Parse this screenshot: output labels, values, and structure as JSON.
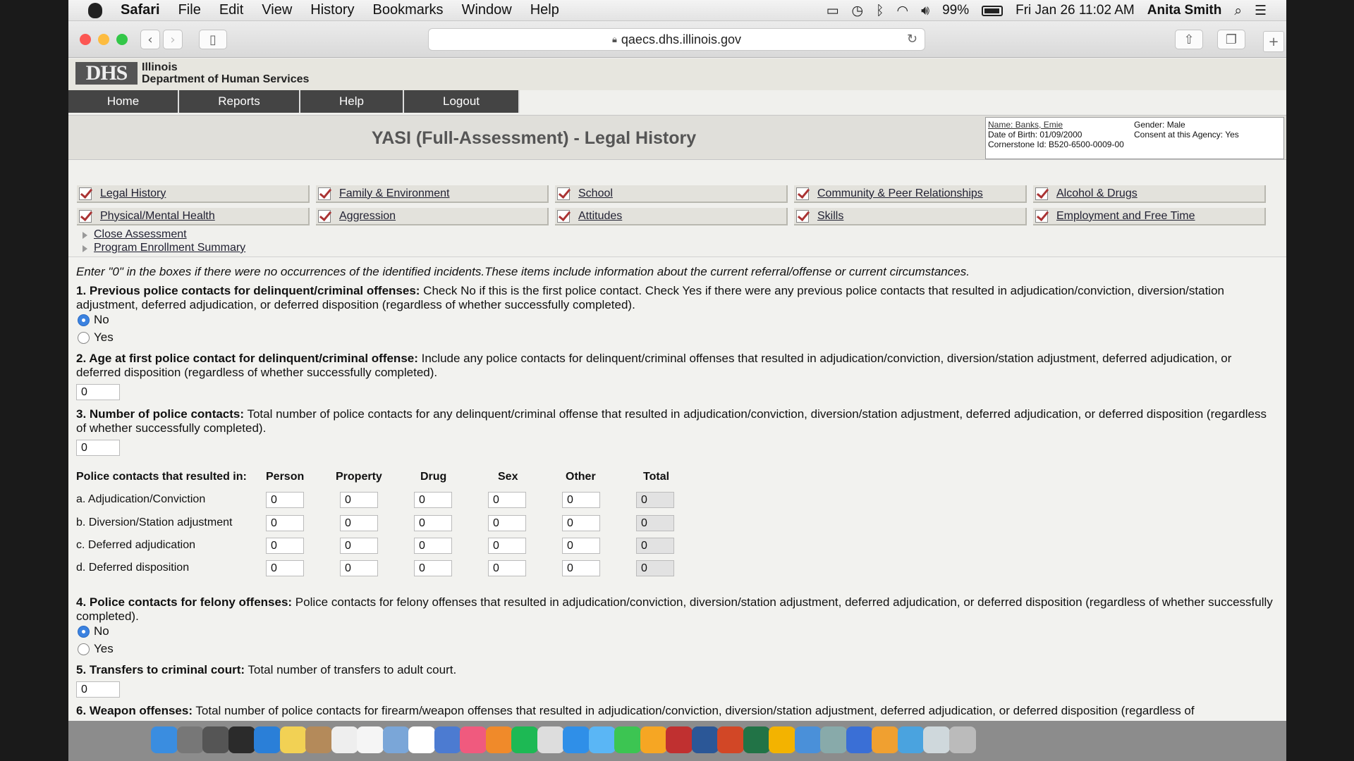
{
  "menubar": {
    "app": "Safari",
    "items": [
      "File",
      "Edit",
      "View",
      "History",
      "Bookmarks",
      "Window",
      "Help"
    ],
    "battery": "99%",
    "datetime": "Fri Jan 26  11:02 AM",
    "user": "Anita Smith"
  },
  "browser": {
    "url": "qaecs.dhs.illinois.gov"
  },
  "site": {
    "logo_text": "DHS",
    "org_line1": "Illinois",
    "org_line2": "Department of Human Services",
    "nav": [
      "Home",
      "Reports",
      "Help",
      "Logout"
    ],
    "page_title": "YASI (Full-Assessment) - Legal History"
  },
  "client": {
    "name": "Name: Banks, Emie",
    "dob": "Date of Birth: 01/09/2000",
    "cornerstone": "Cornerstone Id: B520-6500-0009-00",
    "gender": "Gender: Male",
    "consent": "Consent at this Agency: Yes"
  },
  "sections": [
    "Legal History",
    "Family & Environment",
    "School",
    "Community & Peer Relationships",
    "Alcohol & Drugs",
    "Physical/Mental Health",
    "Aggression",
    "Attitudes",
    "Skills",
    "Employment and Free Time"
  ],
  "sublinks": [
    "Close Assessment",
    "Program Enrollment Summary"
  ],
  "form": {
    "intro": "Enter \"0\" in the boxes if there were no occurrences of the identified incidents.These items include information about the current referral/offense or current circumstances.",
    "q1_title": "1. Previous police contacts for delinquent/criminal offenses:",
    "q1_text": " Check No if this is the first police contact. Check Yes if there were any previous police contacts that resulted in adjudication/conviction, diversion/station adjustment, deferred adjudication, or deferred disposition (regardless of whether successfully completed).",
    "q1_selected": "No",
    "opt_no": "No",
    "opt_yes": "Yes",
    "q2_title": "2. Age at first police contact for delinquent/criminal offense:",
    "q2_text": " Include any police contacts for delinquent/criminal offenses that resulted in adjudication/conviction, diversion/station adjustment, deferred adjudication, or deferred disposition (regardless of whether successfully completed).",
    "q2_value": "0",
    "q3_title": "3. Number of police contacts:",
    "q3_text": " Total number of police contacts for any delinquent/criminal offense that resulted in adjudication/conviction, diversion/station adjustment, deferred adjudication, or deferred disposition (regardless of whether successfully completed).",
    "q3_value": "0",
    "table_header": [
      "Police contacts that resulted in:",
      "Person",
      "Property",
      "Drug",
      "Sex",
      "Other",
      "Total"
    ],
    "table_rows": [
      {
        "label": "a. Adjudication/Conviction",
        "values": [
          "0",
          "0",
          "0",
          "0",
          "0",
          "0"
        ]
      },
      {
        "label": "b. Diversion/Station adjustment",
        "values": [
          "0",
          "0",
          "0",
          "0",
          "0",
          "0"
        ]
      },
      {
        "label": "c. Deferred adjudication",
        "values": [
          "0",
          "0",
          "0",
          "0",
          "0",
          "0"
        ]
      },
      {
        "label": "d. Deferred disposition",
        "values": [
          "0",
          "0",
          "0",
          "0",
          "0",
          "0"
        ]
      }
    ],
    "q4_title": "4. Police contacts for felony offenses:",
    "q4_text": " Police contacts for felony offenses that resulted in adjudication/conviction, diversion/station adjustment, deferred adjudication, or deferred disposition (regardless of whether successfully completed).",
    "q4_selected": "No",
    "q5_title": "5. Transfers to criminal court:",
    "q5_text": " Total number of transfers to adult court.",
    "q5_value": "0",
    "q6_title": "6. Weapon offenses:",
    "q6_text": " Total number of police contacts for firearm/weapon offenses that resulted in adjudication/conviction, diversion/station adjustment, deferred adjudication, or deferred disposition (regardless of"
  },
  "dock_icons": [
    "finder-icon",
    "system-preferences-icon",
    "launchpad-icon",
    "mission-control-icon",
    "app-store-icon",
    "notes-icon",
    "contacts-icon",
    "text-edit-icon",
    "pages-icon",
    "preview-icon",
    "calendar-icon",
    "photo-icon",
    "itunes-icon",
    "ibooks-icon",
    "spotify-icon",
    "chrome-icon",
    "safari-icon",
    "messages-icon",
    "facetime-icon",
    "photos-icon",
    "photo-booth-icon",
    "word-icon",
    "powerpoint-icon",
    "excel-icon",
    "outlook-icon",
    "network-icon",
    "utility-icon",
    "clean-icon",
    "settings-icon",
    "folder-icon",
    "documents-icon",
    "trash-icon"
  ],
  "colors": {
    "nav_bg": "#444444",
    "radio_selected": "#3b82e0",
    "check_mark": "#aa3333"
  }
}
